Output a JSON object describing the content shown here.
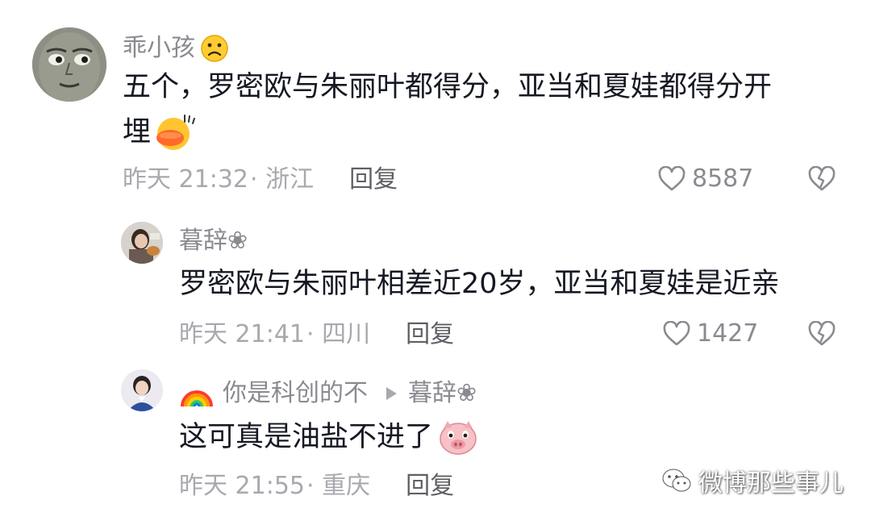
{
  "comments": [
    {
      "username": "乖小孩",
      "text_line1": "五个，罗密欧与朱丽叶都得分，亚当和夏娃都得分开",
      "text_line2": "埋",
      "time": "昨天 21:32",
      "location": "· 浙江",
      "reply_label": "回复",
      "likes": "8587"
    },
    {
      "username": "暮辞❀",
      "text": "罗密欧与朱丽叶相差近20岁，亚当和夏娃是近亲",
      "time": "昨天 21:41",
      "location": "· 四川",
      "reply_label": "回复",
      "likes": "1427"
    },
    {
      "username": "你是科创的不",
      "reply_to": "暮辞❀",
      "text": "这可真是油盐不进了",
      "time": "昨天 21:55",
      "location": "· 重庆",
      "reply_label": "回复"
    }
  ],
  "watermark": "微博那些事儿",
  "colors": {
    "text": "#161823",
    "name": "#8a8b91",
    "meta": "#a8a9ae",
    "reply": "#5f6065"
  },
  "icons": [
    "heart-outline-icon",
    "broken-heart-icon",
    "frowning-face-emoji",
    "rainbow-emoji",
    "pig-face-emoji",
    "duck-emoji"
  ]
}
